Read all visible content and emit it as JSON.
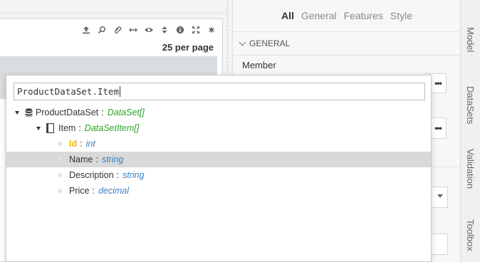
{
  "grid": {
    "toolbar_icons": [
      "upload-icon",
      "search-icon",
      "attach-icon",
      "resize-horizontal-icon",
      "eye-icon",
      "sort-icon",
      "info-icon",
      "fullscreen-icon",
      "settings-icon"
    ],
    "per_page_label": "25 per page"
  },
  "props": {
    "tabs": [
      {
        "label": "All",
        "active": true
      },
      {
        "label": "General",
        "active": false
      },
      {
        "label": "Features",
        "active": false
      },
      {
        "label": "Style",
        "active": false
      }
    ],
    "section_title": "GENERAL",
    "member_label": "Member",
    "ellipsis_label": "•••"
  },
  "side_tabs": [
    "Model",
    "DataSets",
    "Validation",
    "Toolbox"
  ],
  "popup": {
    "path_value": "ProductDataSet.Item",
    "tree": [
      {
        "name": "ProductDataSet",
        "type": "DataSet[]",
        "icon": "database-icon",
        "level": 0,
        "expanded": true,
        "key": false,
        "type_color": "green"
      },
      {
        "name": "Item",
        "type": "DataSetItem[]",
        "icon": "document-icon",
        "level": 1,
        "expanded": true,
        "key": false,
        "type_color": "green"
      },
      {
        "name": "Id",
        "type": "int",
        "icon": "field-dot-icon",
        "level": 2,
        "key": true,
        "type_color": "blue"
      },
      {
        "name": "Name",
        "type": "string",
        "icon": "field-dot-icon",
        "level": 2,
        "key": false,
        "selected": true,
        "type_color": "blue"
      },
      {
        "name": "Description",
        "type": "string",
        "icon": "field-dot-icon",
        "level": 2,
        "key": false,
        "type_color": "blue"
      },
      {
        "name": "Price",
        "type": "decimal",
        "icon": "field-dot-icon",
        "level": 2,
        "key": false,
        "type_color": "blue"
      }
    ]
  },
  "colors": {
    "key_field": "#f2b400",
    "collection_type": "#2aa52a",
    "scalar_type": "#3a7fc4",
    "selected_row": "#d9d9d9"
  }
}
